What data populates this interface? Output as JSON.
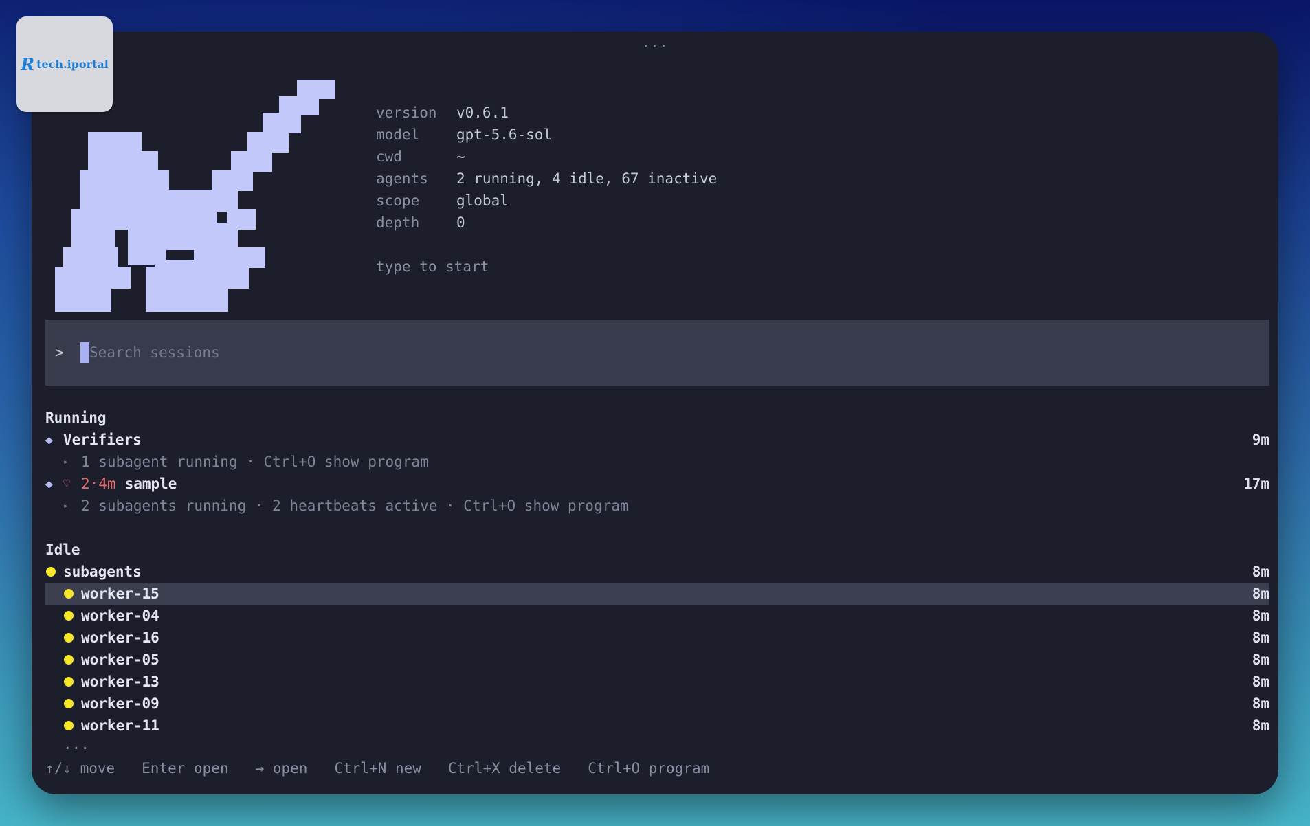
{
  "window": {
    "menu_dots": "...",
    "logo": {
      "mark": "R",
      "text": "tech.iportal"
    }
  },
  "info": {
    "rows": [
      {
        "key": "version",
        "value": "v0.6.1"
      },
      {
        "key": "model",
        "value": "gpt-5.6-sol"
      },
      {
        "key": "cwd",
        "value": "~"
      },
      {
        "key": "agents",
        "value": "2 running, 4 idle, 67 inactive"
      },
      {
        "key": "scope",
        "value": "global"
      },
      {
        "key": "depth",
        "value": "0"
      }
    ],
    "hint": "type to start"
  },
  "search": {
    "prompt": ">",
    "placeholder": "Search sessions",
    "value": ""
  },
  "running": {
    "title": "Running",
    "sessions": [
      {
        "icon": "diamond-icon",
        "name": "Verifiers",
        "time": "9m",
        "detail": "1 subagent running · Ctrl+O show program"
      },
      {
        "icon": "diamond-icon",
        "heartbeat_time": "2·4m",
        "name": "sample",
        "time": "17m",
        "detail": "2 subagents running · 2 heartbeats active · Ctrl+O show program"
      }
    ]
  },
  "idle": {
    "title": "Idle",
    "group": {
      "name": "subagents",
      "time": "8m"
    },
    "workers": [
      {
        "name": "worker-15",
        "time": "8m",
        "selected": true
      },
      {
        "name": "worker-04",
        "time": "8m"
      },
      {
        "name": "worker-16",
        "time": "8m"
      },
      {
        "name": "worker-05",
        "time": "8m"
      },
      {
        "name": "worker-13",
        "time": "8m"
      },
      {
        "name": "worker-09",
        "time": "8m"
      },
      {
        "name": "worker-11",
        "time": "8m"
      }
    ],
    "more": "..."
  },
  "footer": {
    "hints": [
      "↑/↓ move",
      "Enter open",
      "→ open",
      "Ctrl+N new",
      "Ctrl+X delete",
      "Ctrl+O program"
    ]
  },
  "colors": {
    "window_bg": "#1c1e2b",
    "search_bg": "#383b4b",
    "accent": "#b2b8f0",
    "idle_dot": "#f6e826",
    "heartbeat": "#e86a6a"
  },
  "icons": {
    "running_session": "diamond-icon",
    "heartbeat": "heart-icon",
    "idle_session": "yellow-dot-icon",
    "subagent_detail": "triangle-right-icon"
  }
}
